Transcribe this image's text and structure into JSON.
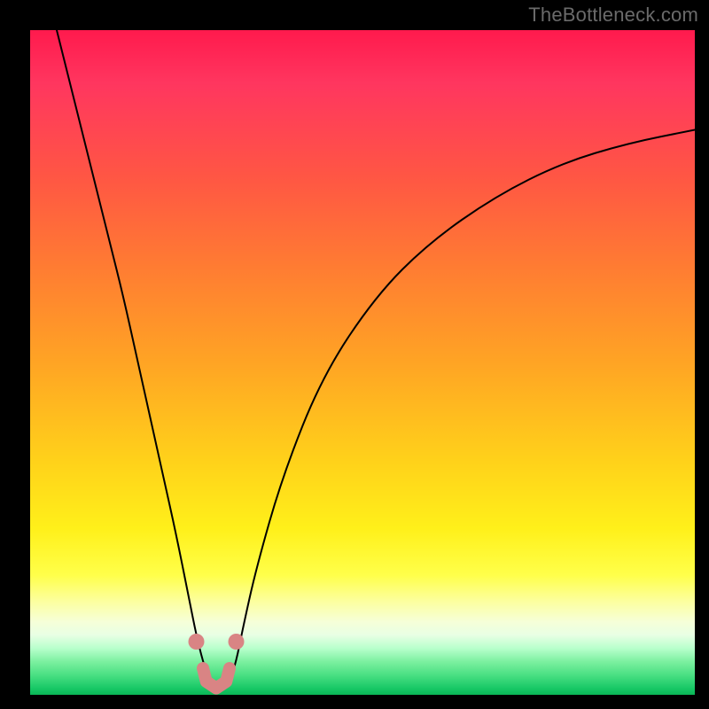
{
  "watermark": "TheBottleneck.com",
  "chart_data": {
    "type": "line",
    "title": "",
    "xlabel": "",
    "ylabel": "",
    "xlim": [
      0,
      100
    ],
    "ylim": [
      0,
      100
    ],
    "grid": false,
    "series": [
      {
        "name": "bottleneck-curve",
        "color": "#000000",
        "stroke_width": 2,
        "x": [
          4,
          6,
          8,
          10,
          12,
          14,
          16,
          18,
          20,
          22,
          24,
          25,
          26,
          27,
          28,
          29,
          30,
          31,
          32,
          34,
          38,
          44,
          52,
          60,
          70,
          80,
          90,
          100
        ],
        "y": [
          100,
          92,
          84,
          76,
          68,
          60,
          51,
          42,
          33,
          24,
          14,
          9,
          5,
          2,
          1,
          1,
          2,
          5,
          10,
          19,
          33,
          48,
          60,
          68,
          75,
          80,
          83,
          85
        ]
      }
    ],
    "markers": [
      {
        "name": "left-dot",
        "x": 25.0,
        "y": 8,
        "color": "#d98484"
      },
      {
        "name": "right-dot",
        "x": 31.0,
        "y": 8,
        "color": "#d98484"
      }
    ],
    "floor_segment": {
      "name": "minimum-band",
      "color": "#d98484",
      "stroke_width": 14,
      "points": [
        {
          "x": 26.0,
          "y": 4
        },
        {
          "x": 26.5,
          "y": 2
        },
        {
          "x": 28.0,
          "y": 1
        },
        {
          "x": 29.5,
          "y": 2
        },
        {
          "x": 30.0,
          "y": 4
        }
      ]
    },
    "minimum_x": 28
  }
}
